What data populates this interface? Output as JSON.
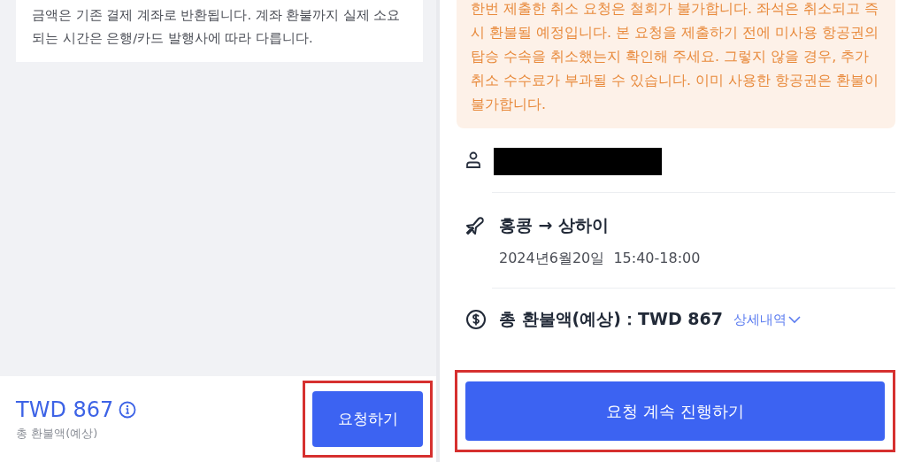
{
  "left_screen": {
    "notice": "금액은 기존 결제 계좌로 반환됩니다. 계좌 환불까지 실제 소요되는 시간은 은행/카드 발행사에 따라 다릅니다.",
    "footer": {
      "amount": "TWD 867",
      "caption": "총 환불액(예상)",
      "button": "요청하기",
      "highlighted": true
    }
  },
  "right_screen": {
    "warning": "한번 제출한 취소 요청은 철회가 불가합니다. 좌석은 취소되고 즉시 환불될 예정입니다. 본 요청을 제출하기 전에 미사용 항공권의 탑승 수속을 취소했는지 확인해 주세요. 그렇지 않을 경우, 추가 취소 수수료가 부과될 수 있습니다. 이미 사용한 항공권은 환불이 불가합니다.",
    "passenger": {
      "redacted": true
    },
    "flight": {
      "route": "홍콩 → 상하이",
      "date": "2024년6월20일  15:40-18:00"
    },
    "refund": {
      "label": "총 환불액(예상)：TWD **867**",
      "details_link": "상세내역"
    },
    "button": "요청 계속 진행하기",
    "highlighted": true
  }
}
